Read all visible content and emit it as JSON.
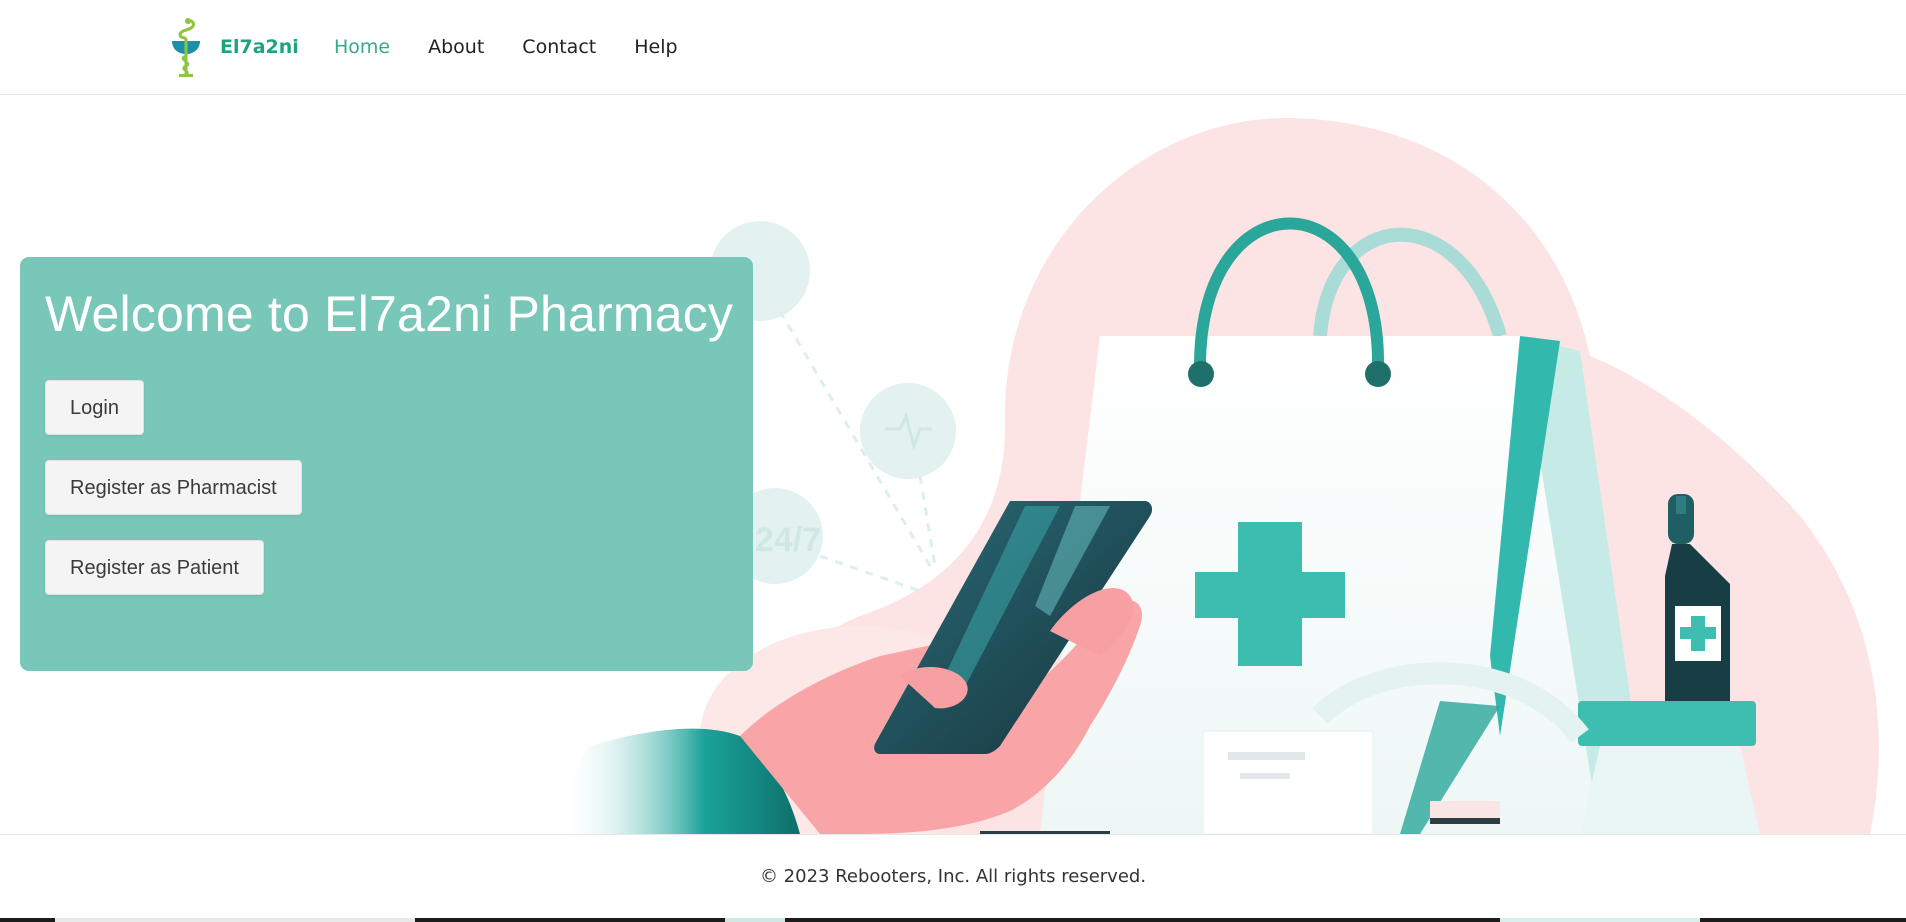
{
  "header": {
    "brand_name": "El7a2ni",
    "logo_icon": "caduceus-bowl-icon",
    "nav": [
      {
        "label": "Home",
        "active": true
      },
      {
        "label": "About",
        "active": false
      },
      {
        "label": "Contact",
        "active": false
      },
      {
        "label": "Help",
        "active": false
      }
    ]
  },
  "hero": {
    "title": "Welcome to El7a2ni Pharmacy",
    "buttons": {
      "login": "Login",
      "register_pharmacist": "Register as Pharmacist",
      "register_patient": "Register as Patient"
    },
    "illustration": "pharmacy-shopping-bag-phone-illustration",
    "badge_text": "24/7"
  },
  "footer": {
    "copyright": "© 2023 Rebooters, Inc. All rights reserved."
  },
  "colors": {
    "brand": "#1fa37c",
    "nav_active": "#3aa98a",
    "card": "#79c7b9",
    "teal": "#2bb3a7",
    "pink": "#fde2e2"
  }
}
